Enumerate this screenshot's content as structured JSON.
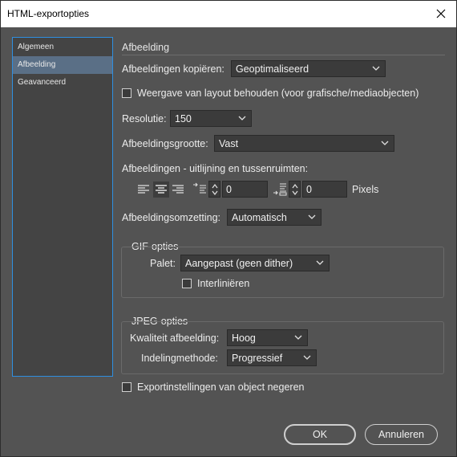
{
  "window": {
    "title": "HTML-exportopties"
  },
  "sidebar": {
    "items": [
      "Algemeen",
      "Afbeelding",
      "Geavanceerd"
    ],
    "selected": "Afbeelding"
  },
  "section": {
    "title": "Afbeelding"
  },
  "copy_images": {
    "label": "Afbeeldingen kopiëren:",
    "value": "Geoptimaliseerd"
  },
  "preserve_layout": {
    "label": "Weergave van layout behouden (voor grafische/mediaobjecten)",
    "checked": false
  },
  "resolution": {
    "label": "Resolutie:",
    "value": "150"
  },
  "image_size": {
    "label": "Afbeeldingsgrootte:",
    "value": "Vast"
  },
  "alignment": {
    "label": "Afbeeldingen - uitlijning en tussenruimten:",
    "space_before": "0",
    "space_after": "0",
    "unit": "Pixels",
    "selected_alignment": "center"
  },
  "conversion": {
    "label": "Afbeeldingsomzetting:",
    "value": "Automatisch"
  },
  "gif": {
    "title": "GIF-opties",
    "palette_label": "Palet:",
    "palette_value": "Aangepast (geen dither)",
    "interlace_label": "Interliniëren",
    "interlace_checked": false
  },
  "jpeg": {
    "title": "JPEG-opties",
    "quality_label": "Kwaliteit afbeelding:",
    "quality_value": "Hoog",
    "method_label": "Indelingmethode:",
    "method_value": "Progressief"
  },
  "ignore_export": {
    "label": "Exportinstellingen van object negeren",
    "checked": false
  },
  "buttons": {
    "ok": "OK",
    "cancel": "Annuleren"
  },
  "colors": {
    "background": "#535353",
    "sidebar_selected": "#5a6f86",
    "focus_border": "#2f8fe0"
  }
}
